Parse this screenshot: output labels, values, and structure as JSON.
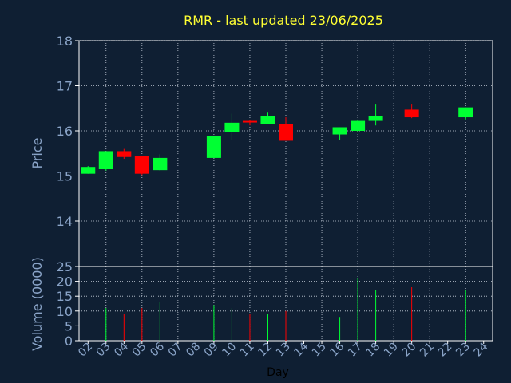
{
  "chart_data": [
    {
      "type": "candlestick",
      "title": "RMR - last updated 23/06/2025",
      "xlabel": "",
      "ylabel": "Price",
      "ylim": [
        14,
        18
      ],
      "yticks": [
        "14",
        "15",
        "16",
        "17",
        "18"
      ],
      "grid": true,
      "candles": [
        {
          "day": "02",
          "open": 15.05,
          "high": 15.22,
          "low": 15.05,
          "close": 15.2
        },
        {
          "day": "03",
          "open": 15.15,
          "high": 15.55,
          "low": 15.12,
          "close": 15.55
        },
        {
          "day": "04",
          "open": 15.55,
          "high": 15.6,
          "low": 15.38,
          "close": 15.42
        },
        {
          "day": "05",
          "open": 15.45,
          "high": 15.45,
          "low": 15.02,
          "close": 15.05
        },
        {
          "day": "06",
          "open": 15.13,
          "high": 15.48,
          "low": 15.12,
          "close": 15.4
        },
        {
          "day": "09",
          "open": 15.4,
          "high": 15.88,
          "low": 15.4,
          "close": 15.88
        },
        {
          "day": "10",
          "open": 15.98,
          "high": 16.38,
          "low": 15.8,
          "close": 16.18
        },
        {
          "day": "11",
          "open": 16.22,
          "high": 16.24,
          "low": 16.12,
          "close": 16.2
        },
        {
          "day": "12",
          "open": 16.15,
          "high": 16.42,
          "low": 16.15,
          "close": 16.32
        },
        {
          "day": "13",
          "open": 16.15,
          "high": 16.3,
          "low": 15.78,
          "close": 15.78
        },
        {
          "day": "16",
          "open": 15.92,
          "high": 16.08,
          "low": 15.8,
          "close": 16.08
        },
        {
          "day": "17",
          "open": 16.0,
          "high": 16.25,
          "low": 15.98,
          "close": 16.22
        },
        {
          "day": "18",
          "open": 16.22,
          "high": 16.6,
          "low": 16.12,
          "close": 16.33
        },
        {
          "day": "20",
          "open": 16.47,
          "high": 16.6,
          "low": 16.28,
          "close": 16.3
        },
        {
          "day": "23",
          "open": 16.3,
          "high": 16.52,
          "low": 16.25,
          "close": 16.52
        }
      ]
    },
    {
      "type": "bar",
      "xlabel": "Day",
      "ylabel": "Volume (0000)",
      "ylim": [
        0,
        25
      ],
      "yticks": [
        "0",
        "5",
        "10",
        "15",
        "20",
        "25"
      ],
      "categories": [
        "02",
        "03",
        "04",
        "05",
        "06",
        "07",
        "08",
        "09",
        "10",
        "11",
        "12",
        "13",
        "14",
        "15",
        "16",
        "17",
        "18",
        "19",
        "20",
        "21",
        "22",
        "23",
        "24"
      ],
      "volumes": [
        {
          "day": "03",
          "value": 11,
          "direction": "up"
        },
        {
          "day": "04",
          "value": 9,
          "direction": "down"
        },
        {
          "day": "05",
          "value": 11,
          "direction": "down"
        },
        {
          "day": "06",
          "value": 13,
          "direction": "up"
        },
        {
          "day": "09",
          "value": 12,
          "direction": "up"
        },
        {
          "day": "10",
          "value": 11,
          "direction": "up"
        },
        {
          "day": "11",
          "value": 9,
          "direction": "down"
        },
        {
          "day": "12",
          "value": 9,
          "direction": "up"
        },
        {
          "day": "13",
          "value": 10,
          "direction": "down"
        },
        {
          "day": "16",
          "value": 8,
          "direction": "up"
        },
        {
          "day": "17",
          "value": 21,
          "direction": "up"
        },
        {
          "day": "18",
          "value": 17,
          "direction": "up"
        },
        {
          "day": "20",
          "value": 18,
          "direction": "down"
        },
        {
          "day": "23",
          "value": 17,
          "direction": "up"
        }
      ]
    }
  ],
  "colors": {
    "background": "#0f1f33",
    "axis": "#ffffff",
    "grid": "#c8d0dc",
    "title": "#ffff33",
    "label": "#8aa4c8",
    "up": "#00ff33",
    "down": "#ff0000"
  }
}
